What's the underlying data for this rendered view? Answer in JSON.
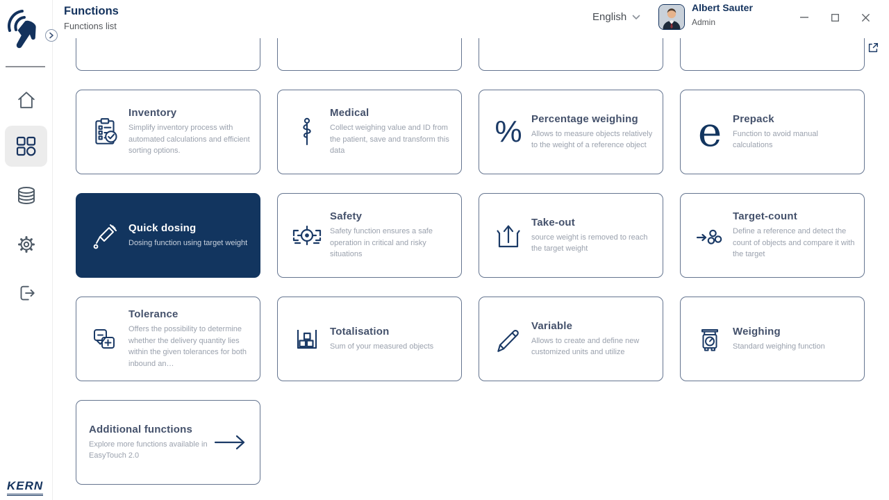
{
  "app": {
    "title": "Functions",
    "subtitle": "Functions list",
    "brand": "KERN"
  },
  "header": {
    "language": "English",
    "user_name": "Albert Sauter",
    "user_role": "Admin"
  },
  "sidebar": {
    "items": [
      {
        "name": "home",
        "selected": false
      },
      {
        "name": "functions",
        "selected": true
      },
      {
        "name": "database",
        "selected": false
      },
      {
        "name": "settings",
        "selected": false
      },
      {
        "name": "logout",
        "selected": false
      }
    ]
  },
  "colors": {
    "accent": "#13325d",
    "selected_card_bg": "#12355f",
    "card_border": "#64748f",
    "desc_text": "#9aa1ad"
  },
  "cards": [
    {
      "title": "Inventory",
      "desc": "Simplify inventory process with automated calculations and efficient sorting options.",
      "icon": "inventory-checklist-icon",
      "selected": false
    },
    {
      "title": "Medical",
      "desc": "Collect weighing value and ID from the patient, save and transform this data",
      "icon": "medical-staff-icon",
      "selected": false
    },
    {
      "title": "Percentage weighing",
      "desc": "Allows to measure objects relatively to the weight of a reference object",
      "icon": "percent-icon",
      "selected": false
    },
    {
      "title": "Prepack",
      "desc": "Function to avoid manual calculations",
      "icon": "prepack-e-icon",
      "selected": false
    },
    {
      "title": "Quick dosing",
      "desc": "Dosing function using target weight",
      "icon": "dosing-pipette-icon",
      "selected": true
    },
    {
      "title": "Safety",
      "desc": "Safety function ensures a safe operation in critical and risky situations",
      "icon": "safety-target-icon",
      "selected": false
    },
    {
      "title": "Take-out",
      "desc": "source weight is removed to reach the target weight",
      "icon": "take-out-icon",
      "selected": false
    },
    {
      "title": "Target-count",
      "desc": "Define a reference and detect the count of objects and compare it with the target",
      "icon": "target-count-icon",
      "selected": false
    },
    {
      "title": "Tolerance",
      "desc": "Offers the possibility to determine whether the delivery quantity lies within the given tolerances for both inbound an…",
      "icon": "tolerance-icon",
      "selected": false
    },
    {
      "title": "Totalisation",
      "desc": "Sum of your measured objects",
      "icon": "totalisation-icon",
      "selected": false
    },
    {
      "title": "Variable",
      "desc": "Allows to create and define new customized units and utilize",
      "icon": "variable-pencil-icon",
      "selected": false
    },
    {
      "title": "Weighing",
      "desc": "Standard weighing function",
      "icon": "weighing-scale-icon",
      "selected": false
    }
  ],
  "additional_card": {
    "title": "Additional functions",
    "desc": "Explore more functions available in EasyTouch 2.0"
  }
}
